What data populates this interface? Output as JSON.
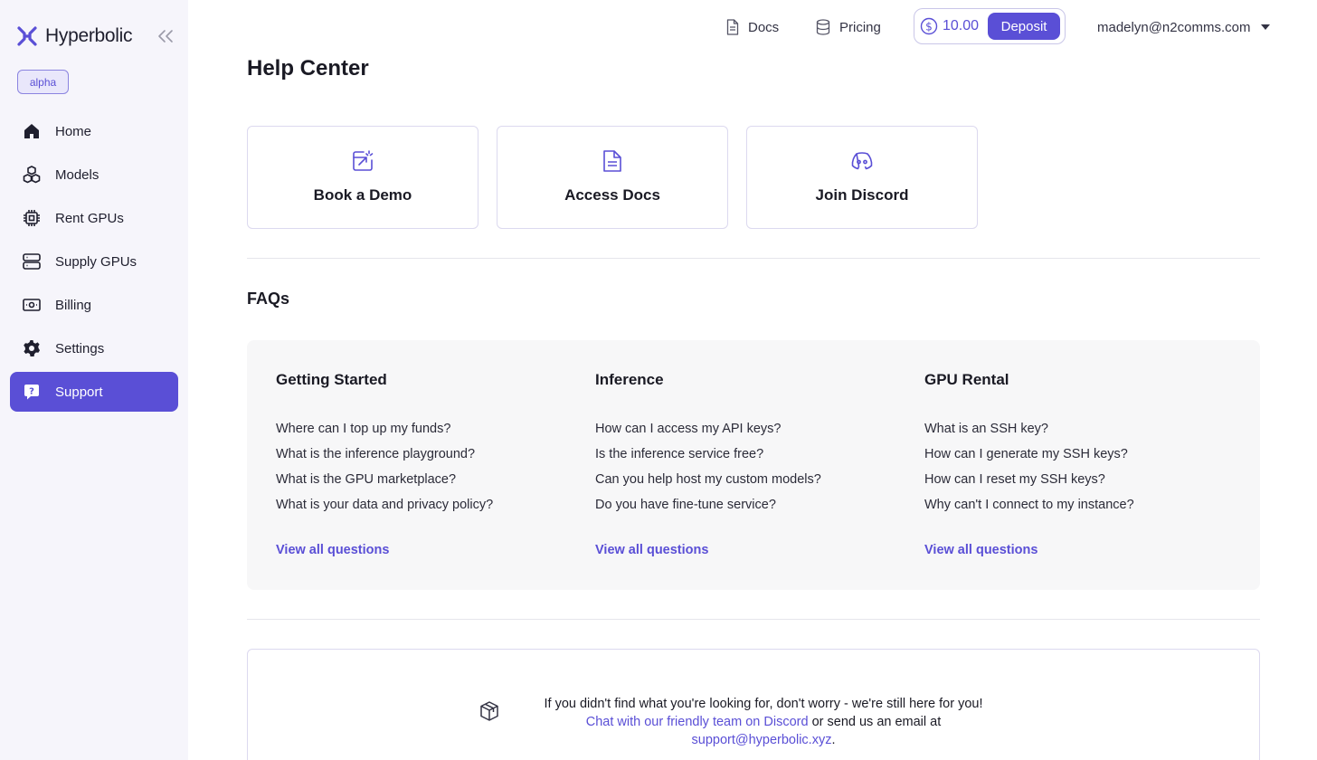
{
  "sidebar": {
    "brand": "Hyperbolic",
    "badge": "alpha",
    "items": [
      {
        "label": "Home",
        "icon": "home-icon"
      },
      {
        "label": "Models",
        "icon": "cubes-icon"
      },
      {
        "label": "Rent GPUs",
        "icon": "chip-icon"
      },
      {
        "label": "Supply GPUs",
        "icon": "server-icon"
      },
      {
        "label": "Billing",
        "icon": "cash-icon"
      },
      {
        "label": "Settings",
        "icon": "gear-icon"
      },
      {
        "label": "Support",
        "icon": "support-chat-icon",
        "active": true
      }
    ]
  },
  "header": {
    "docs_label": "Docs",
    "pricing_label": "Pricing",
    "balance": "10.00",
    "deposit_label": "Deposit",
    "user_email": "madelyn@n2comms.com"
  },
  "main": {
    "title": "Help Center",
    "cards": [
      {
        "label": "Book a Demo",
        "icon": "calendar-link-icon"
      },
      {
        "label": "Access Docs",
        "icon": "document-icon"
      },
      {
        "label": "Join Discord",
        "icon": "discord-icon"
      }
    ],
    "faq": {
      "title": "FAQs",
      "columns": [
        {
          "title": "Getting Started",
          "questions": [
            "Where can I top up my funds?",
            "What is the inference playground?",
            "What is the GPU marketplace?",
            "What is your data and privacy policy?"
          ],
          "view_all": "View all questions"
        },
        {
          "title": "Inference",
          "questions": [
            "How can I access my API keys?",
            "Is the inference service free?",
            "Can you help host my custom models?",
            "Do you have fine-tune service?"
          ],
          "view_all": "View all questions"
        },
        {
          "title": "GPU Rental",
          "questions": [
            "What is an SSH key?",
            "How can I generate my SSH keys?",
            "How can I reset my SSH keys?",
            "Why can't I connect to my instance?"
          ],
          "view_all": "View all questions"
        }
      ]
    },
    "help": {
      "line1": "If you didn't find what you're looking for, don't worry - we're still here for you!",
      "discord_link": "Chat with our friendly team on Discord",
      "middle_text": "or send us an email at",
      "email_link": "support@hyperbolic.xyz",
      "end_text": "."
    }
  },
  "colors": {
    "accent": "#5a4fd6",
    "sidebar_bg": "#f6f5fb",
    "faq_bg": "#f7f7f8"
  }
}
